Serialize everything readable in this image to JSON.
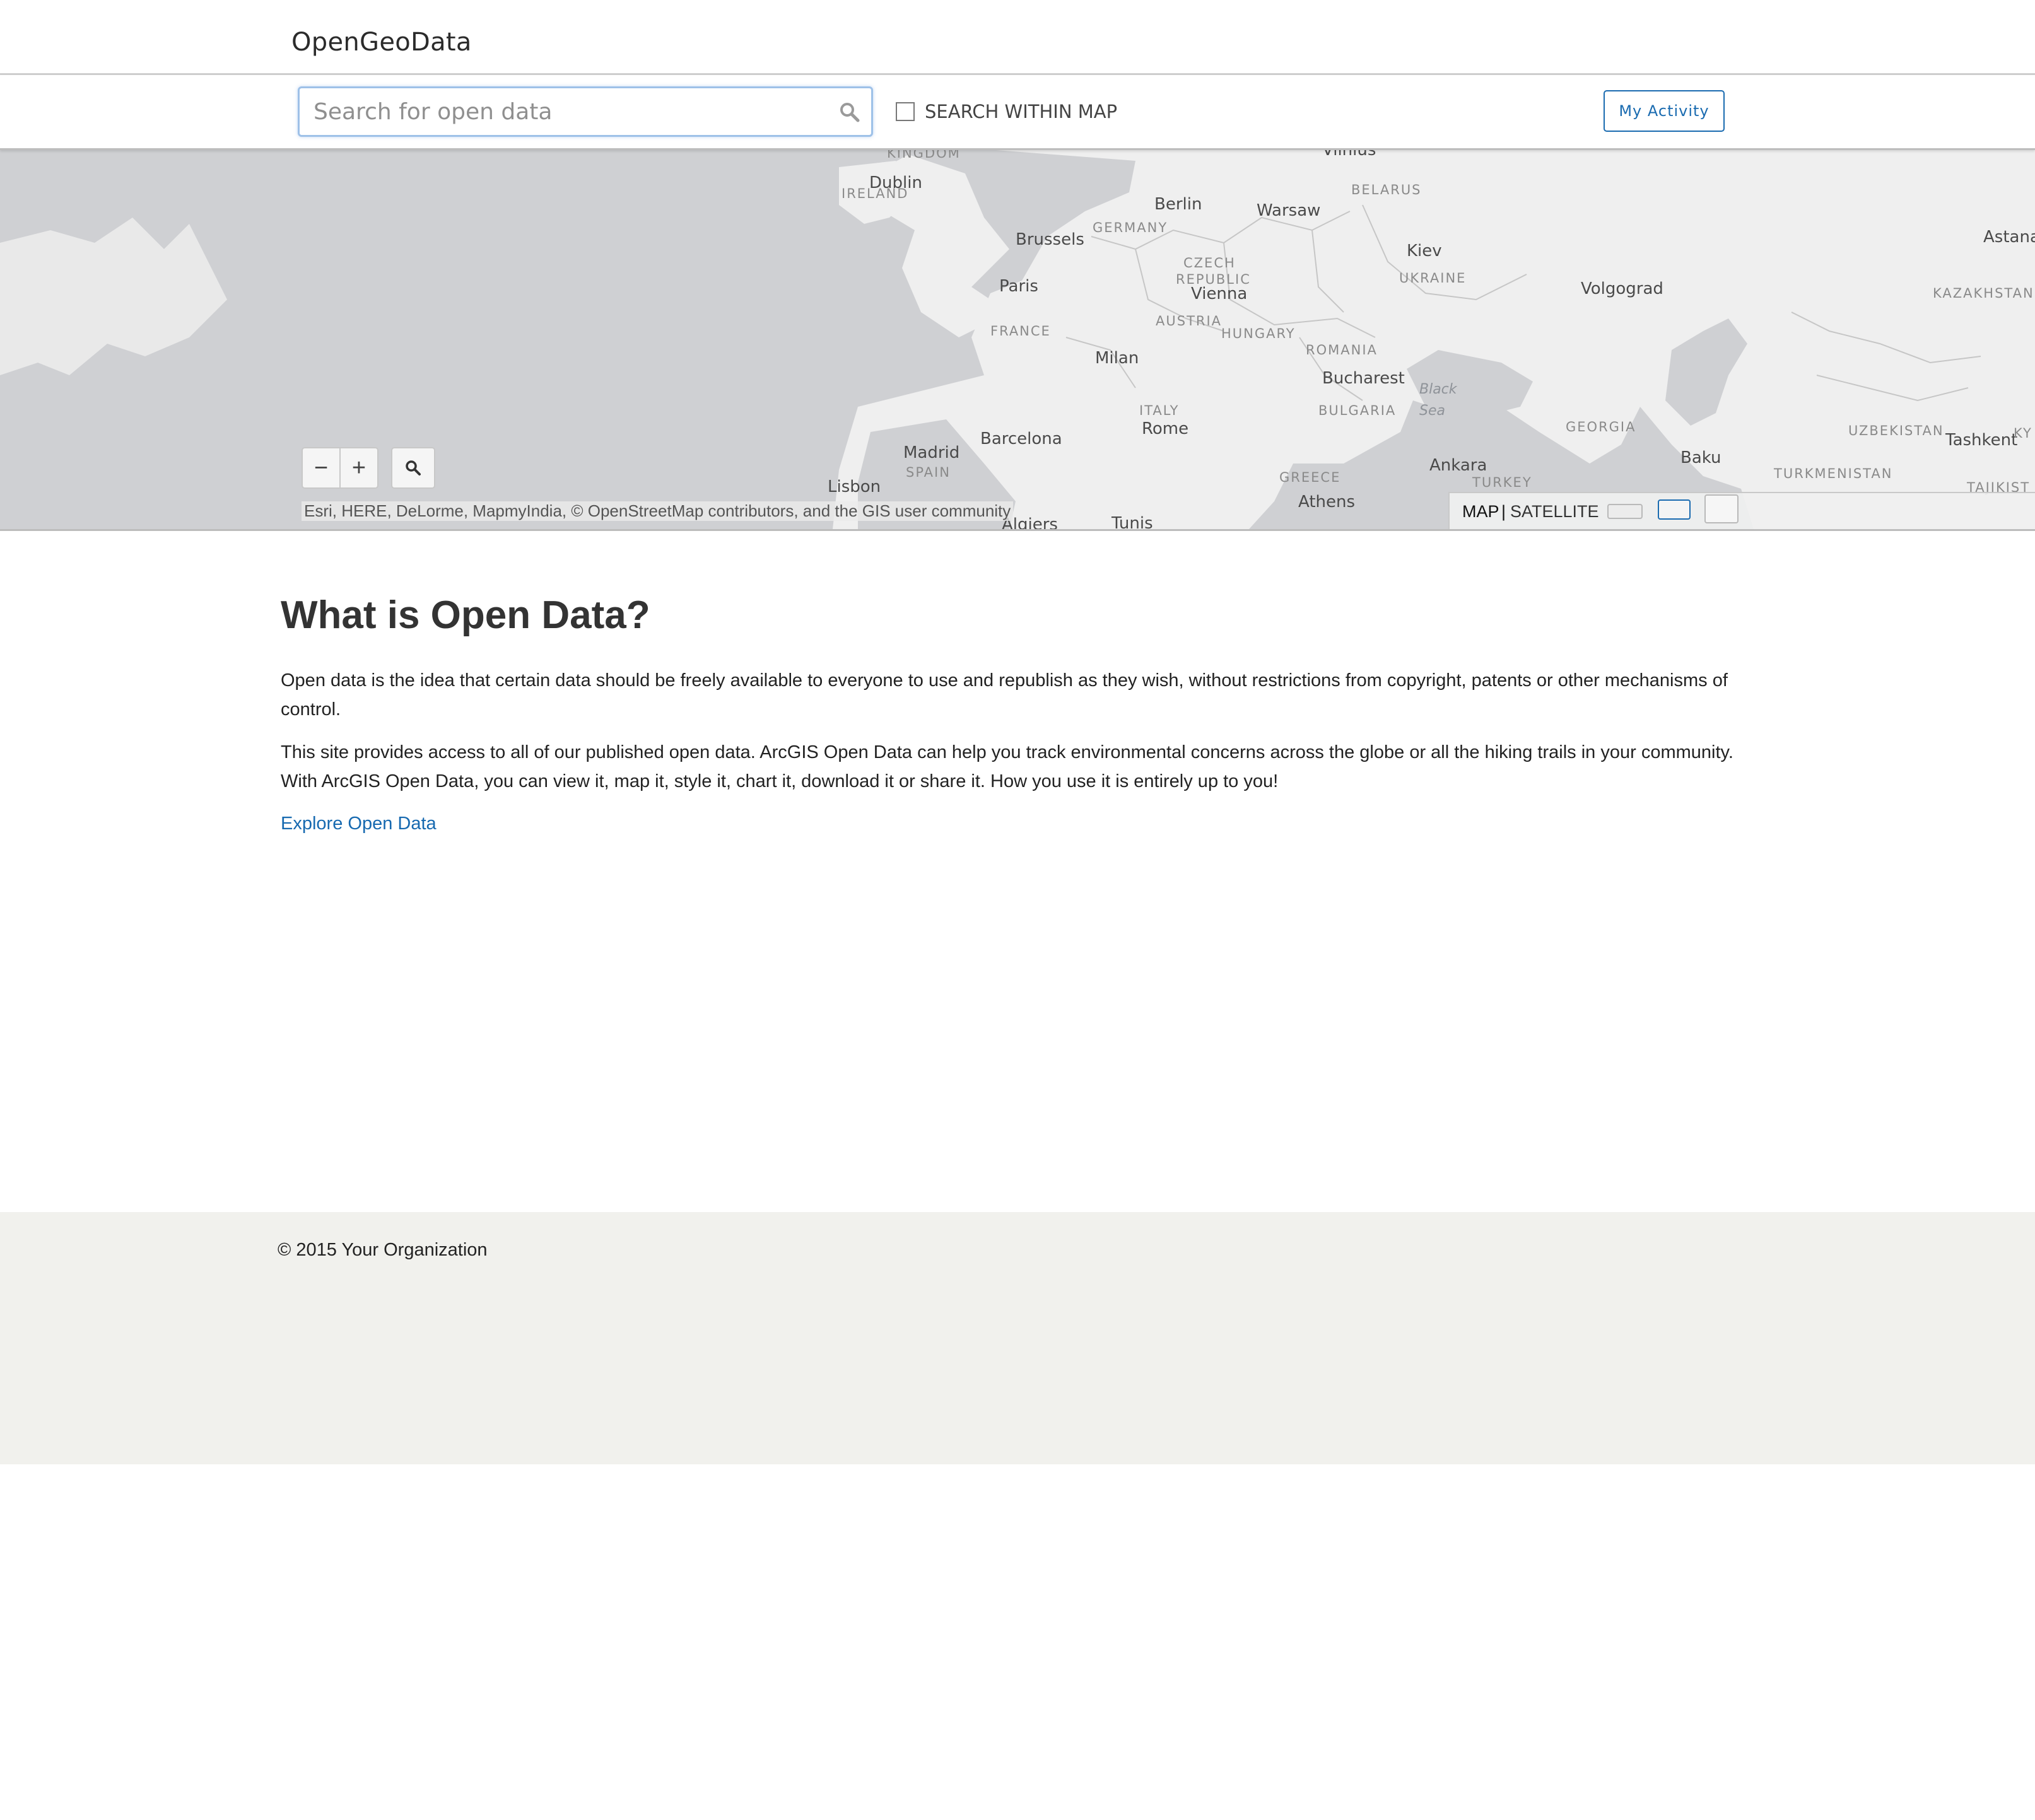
{
  "header": {
    "brand": "OpenGeoData"
  },
  "search": {
    "placeholder": "Search for open data",
    "value": "",
    "within_map_label": "SEARCH WITHIN MAP",
    "within_map_checked": false,
    "activity_button": "My Activity"
  },
  "map": {
    "cities": [
      "Dublin",
      "Berlin",
      "Warsaw",
      "Brussels",
      "Kiev",
      "Paris",
      "Vienna",
      "Volgograd",
      "Milan",
      "Bucharest",
      "Rome",
      "Barcelona",
      "Madrid",
      "Lisbon",
      "Ankara",
      "Baku",
      "Athens",
      "Tashkent",
      "Astana",
      "Algiers",
      "Tunis",
      "Vilnius"
    ],
    "countries": [
      "KINGDOM",
      "IRELAND",
      "BELARUS",
      "GERMANY",
      "CZECH",
      "REPUBLIC",
      "UKRAINE",
      "KAZAKHSTAN",
      "FRANCE",
      "AUSTRIA",
      "HUNGARY",
      "ROMANIA",
      "BULGARIA",
      "ITALY",
      "SPAIN",
      "GEORGIA",
      "UZBEKISTAN",
      "TURKMENISTAN",
      "TURKEY",
      "GREECE",
      "TAJIKIST",
      "KY"
    ],
    "seas": [
      "Black",
      "Sea"
    ],
    "zoom_out": "−",
    "zoom_in": "+",
    "attribution": "Esri, HERE, DeLorme, MapmyIndia, © OpenStreetMap contributors, and the GIS user community",
    "basemap": {
      "map": "MAP",
      "separator": "|",
      "satellite": "SATELLITE"
    },
    "colors": {
      "water": "#cfd0d3",
      "land": "#efefef",
      "border": "#c4c4c4"
    }
  },
  "content": {
    "title": "What is Open Data?",
    "paragraph1": "Open data is the idea that certain data should be freely available to everyone to use and republish as they wish, without restrictions from copyright, patents or other mechanisms of control.",
    "paragraph2": "This site provides access to all of our published open data. ArcGIS Open Data can help you track environmental concerns across the globe or all the hiking trails in your community. With ArcGIS Open Data, you can view it, map it, style it, chart it, download it or share it. How you use it is entirely up to you!",
    "explore_link": "Explore Open Data"
  },
  "footer": {
    "copyright": "© 2015 Your Organization"
  },
  "icons": {
    "search": "search-icon",
    "geolocate": "search-icon",
    "checkbox": "checkbox-icon"
  },
  "colors": {
    "link": "#1669b0",
    "accent_border": "#9ec1e8",
    "footer_bg": "#f1f1ed"
  }
}
